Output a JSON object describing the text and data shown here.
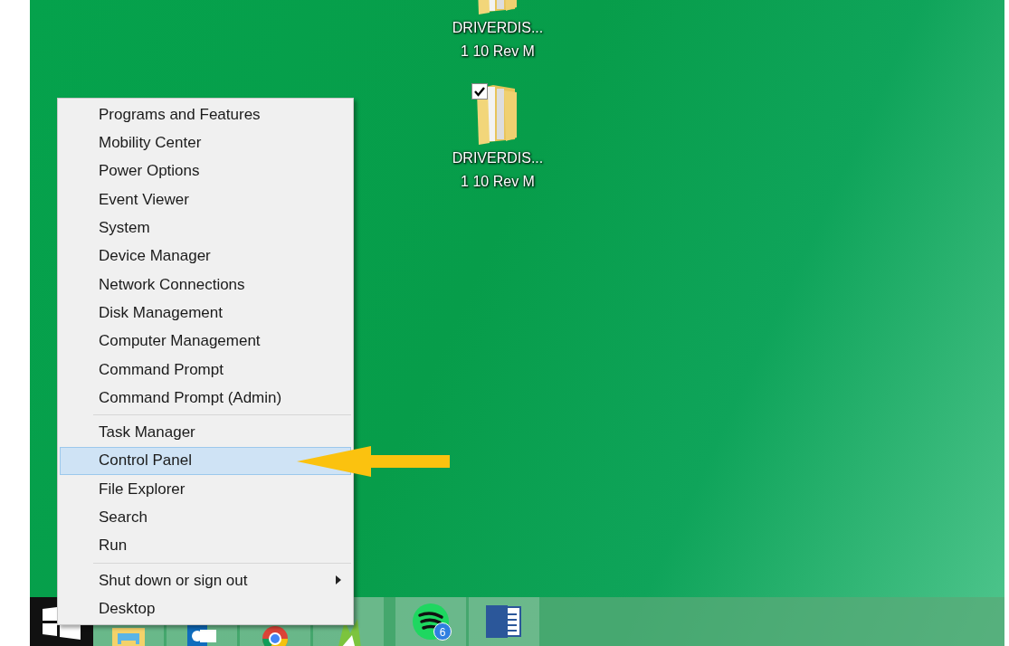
{
  "desktop_icons": [
    {
      "kind": "folder",
      "label": "DRIVERDIS...",
      "label_line2": "1 10 Rev M",
      "checked": false,
      "cut_off": true
    },
    {
      "kind": "folder",
      "label": "DRIVERDIS...",
      "label_line2": "1 10 Rev M",
      "checked": true,
      "cut_off": false
    }
  ],
  "context_menu": {
    "groups": [
      {
        "items": [
          {
            "label": "Programs and Features",
            "selected": false,
            "submenu": false
          },
          {
            "label": "Mobility Center",
            "selected": false,
            "submenu": false
          },
          {
            "label": "Power Options",
            "selected": false,
            "submenu": false
          },
          {
            "label": "Event Viewer",
            "selected": false,
            "submenu": false
          },
          {
            "label": "System",
            "selected": false,
            "submenu": false
          },
          {
            "label": "Device Manager",
            "selected": false,
            "submenu": false
          },
          {
            "label": "Network Connections",
            "selected": false,
            "submenu": false
          },
          {
            "label": "Disk Management",
            "selected": false,
            "submenu": false
          },
          {
            "label": "Computer Management",
            "selected": false,
            "submenu": false
          },
          {
            "label": "Command Prompt",
            "selected": false,
            "submenu": false
          },
          {
            "label": "Command Prompt (Admin)",
            "selected": false,
            "submenu": false
          }
        ]
      },
      {
        "items": [
          {
            "label": "Task Manager",
            "selected": false,
            "submenu": false
          },
          {
            "label": "Control Panel",
            "selected": true,
            "submenu": false
          },
          {
            "label": "File Explorer",
            "selected": false,
            "submenu": false
          },
          {
            "label": "Search",
            "selected": false,
            "submenu": false
          },
          {
            "label": "Run",
            "selected": false,
            "submenu": false
          }
        ]
      },
      {
        "items": [
          {
            "label": "Shut down or sign out",
            "selected": false,
            "submenu": true
          },
          {
            "label": "Desktop",
            "selected": false,
            "submenu": false
          }
        ]
      }
    ]
  },
  "taskbar": {
    "apps": [
      {
        "kind": "file-explorer"
      },
      {
        "kind": "mail"
      },
      {
        "kind": "browser"
      },
      {
        "kind": "draw"
      },
      {
        "kind": "music",
        "badge": "6"
      },
      {
        "kind": "word"
      }
    ]
  }
}
